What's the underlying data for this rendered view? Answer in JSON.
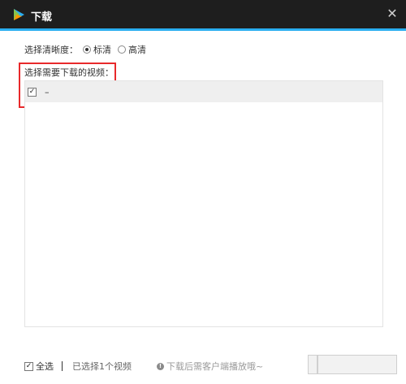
{
  "window": {
    "title": "下载",
    "close_label": "✕"
  },
  "resolution": {
    "label": "选择清晰度：",
    "options": [
      {
        "label": "标清",
        "selected": true
      },
      {
        "label": "高清",
        "selected": false
      }
    ]
  },
  "videos": {
    "label": "选择需要下载的视频：",
    "items": [
      {
        "title": "–",
        "checked": true,
        "check_mark": "✓"
      }
    ]
  },
  "footer": {
    "select_all_label": "全选",
    "select_all_checked": true,
    "check_mark": "✓",
    "selected_count": "已选择1个视频",
    "info_glyph": "!",
    "hint": "下载后需客户端播放哦~"
  },
  "colors": {
    "titlebar": "#1e1e1e",
    "accent": "#2aaef0",
    "highlight": "#e8292b"
  }
}
